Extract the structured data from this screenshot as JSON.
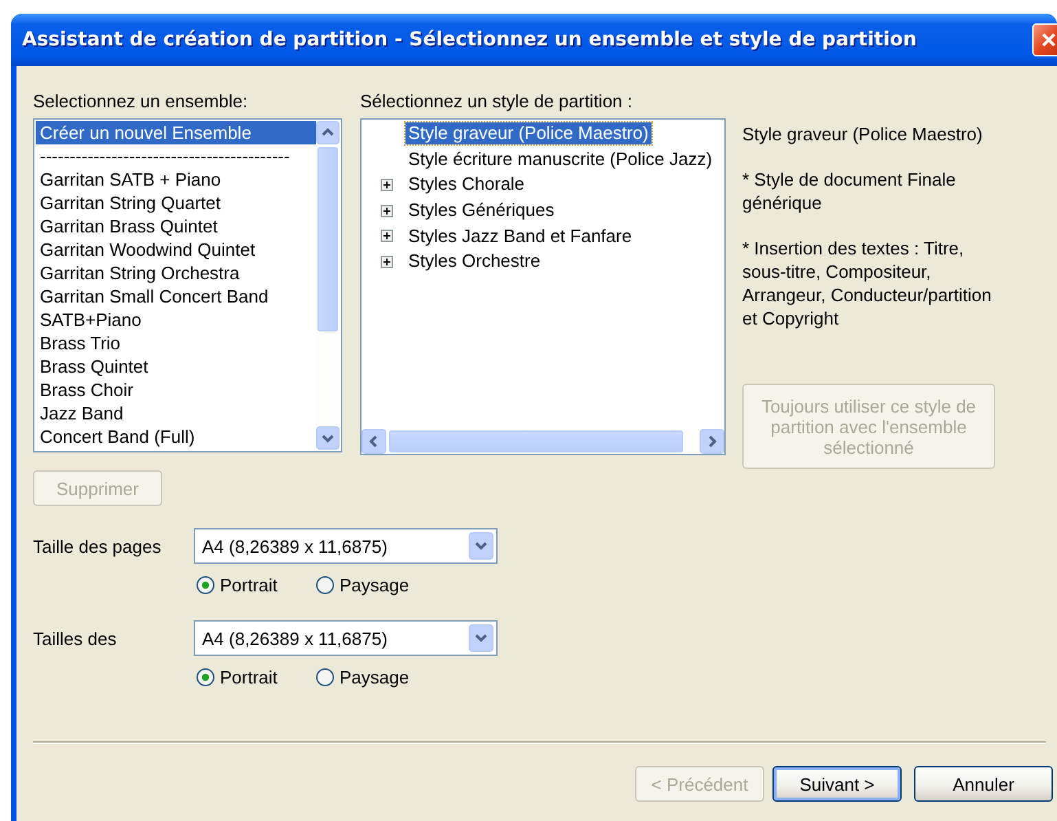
{
  "window": {
    "title": "Assistant de création de partition - Sélectionnez un ensemble et style de partition"
  },
  "ensemble_panel": {
    "label": "Selectionnez un ensemble:",
    "items": [
      {
        "text": "Créer un nouvel Ensemble",
        "selected": true
      },
      {
        "text": "------------------------------------------",
        "selected": false
      },
      {
        "text": "Garritan SATB + Piano",
        "selected": false
      },
      {
        "text": "Garritan String Quartet",
        "selected": false
      },
      {
        "text": "Garritan Brass Quintet",
        "selected": false
      },
      {
        "text": "Garritan Woodwind Quintet",
        "selected": false
      },
      {
        "text": "Garritan String Orchestra",
        "selected": false
      },
      {
        "text": "Garritan Small Concert Band",
        "selected": false
      },
      {
        "text": "SATB+Piano",
        "selected": false
      },
      {
        "text": "Brass Trio",
        "selected": false
      },
      {
        "text": "Brass Quintet",
        "selected": false
      },
      {
        "text": "Brass Choir",
        "selected": false
      },
      {
        "text": "Jazz Band",
        "selected": false
      },
      {
        "text": "Concert Band (Full)",
        "selected": false
      }
    ],
    "delete_button": {
      "label": "Supprimer",
      "disabled": true
    }
  },
  "style_panel": {
    "label": "Sélectionnez un style de partition :",
    "items": [
      {
        "kind": "leaf",
        "text": "Style graveur (Police Maestro)",
        "selected": true
      },
      {
        "kind": "leaf",
        "text": "Style écriture manuscrite (Police Jazz)",
        "selected": false
      },
      {
        "kind": "group",
        "text": "Styles Chorale",
        "selected": false,
        "expanded": false
      },
      {
        "kind": "group",
        "text": "Styles Génériques",
        "selected": false,
        "expanded": false
      },
      {
        "kind": "group",
        "text": "Styles Jazz Band et Fanfare",
        "selected": false,
        "expanded": false
      },
      {
        "kind": "group",
        "text": "Styles Orchestre",
        "selected": false,
        "expanded": false
      }
    ]
  },
  "description": [
    "Style graveur (Police Maestro)",
    "* Style de document Finale générique",
    "* Insertion des textes : Titre, sous-titre, Compositeur, Arrangeur, Conducteur/partition et Copyright"
  ],
  "always_use_button": {
    "label": "Toujours utiliser ce style de partition avec l'ensemble sélectionné",
    "disabled": true
  },
  "page_settings": [
    {
      "label": "Taille des pages",
      "value": "A4 (8,26389 x 11,6875)",
      "orientations": [
        {
          "label": "Portrait",
          "selected": true
        },
        {
          "label": "Paysage",
          "selected": false
        }
      ]
    },
    {
      "label": "Tailles des",
      "value": "A4 (8,26389 x 11,6875)",
      "orientations": [
        {
          "label": "Portrait",
          "selected": true
        },
        {
          "label": "Paysage",
          "selected": false
        }
      ]
    }
  ],
  "buttons": [
    {
      "label": "< Précédent",
      "disabled": true,
      "default": false
    },
    {
      "label": "Suivant >",
      "disabled": false,
      "default": true
    },
    {
      "label": "Annuler",
      "disabled": false,
      "default": false
    }
  ]
}
